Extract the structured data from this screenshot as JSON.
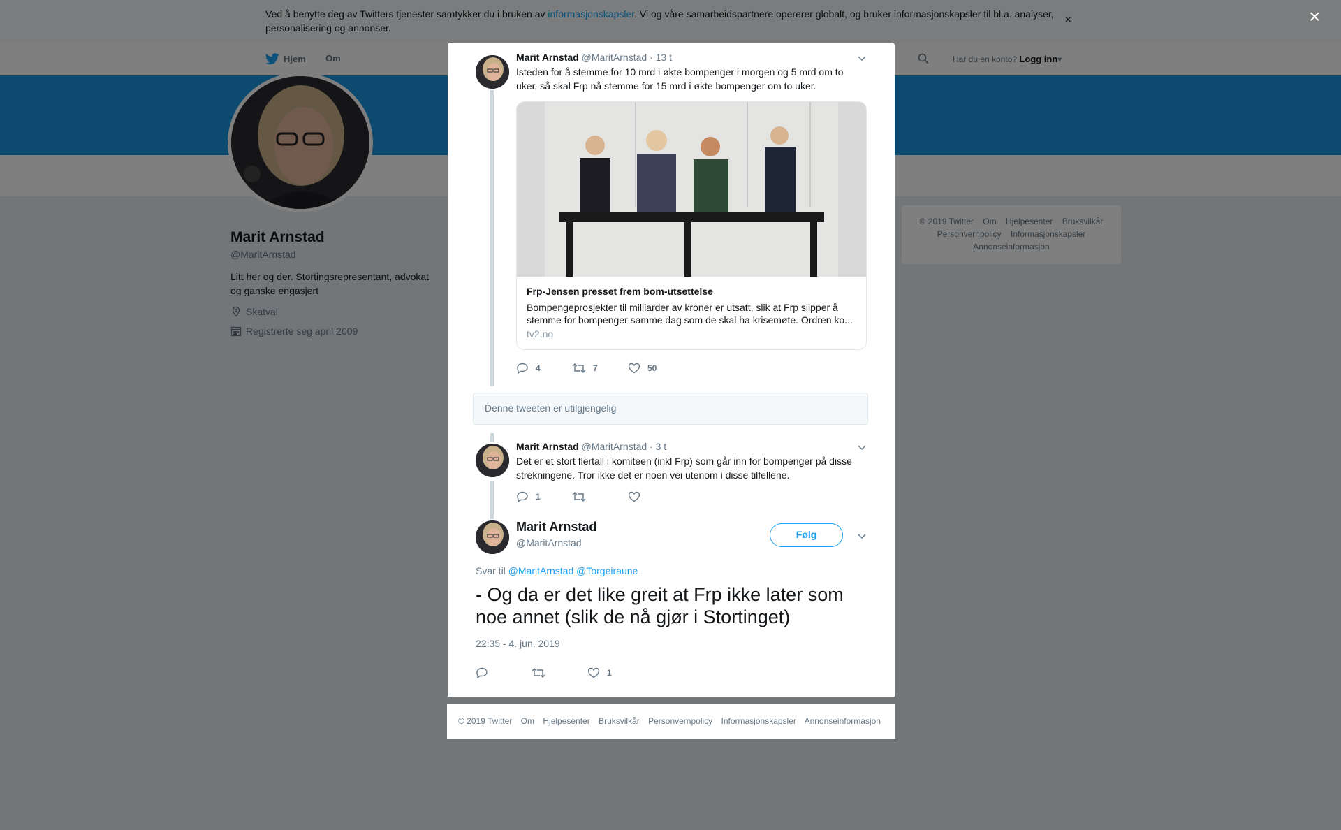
{
  "cookie": {
    "text_before": "Ved å benytte deg av Twitters tjenester samtykker du i bruken av ",
    "link": "informasjonskapsler",
    "text_after": ". Vi og våre samarbeidspartnere opererer globalt, og bruker informasjonskapsler til bl.a. analyser, personalisering og annonser.",
    "close": "×"
  },
  "nav": {
    "home": "Hjem",
    "about": "Om",
    "account_prompt": "Har du en konto?",
    "login": "Logg inn"
  },
  "profile": {
    "name": "Marit Arnstad",
    "handle": "@MaritArnstad",
    "bio": "Litt her og der. Stortingsrepresentant, advokat og ganske engasjert",
    "location": "Skatval",
    "joined": "Registrerte seg april 2009"
  },
  "side_footer": {
    "copyright": "© 2019 Twitter",
    "links": [
      "Om",
      "Hjelpesenter",
      "Bruksvilkår",
      "Personvernpolicy",
      "Informasjonskapsler",
      "Annonseinformasjon"
    ]
  },
  "modal": {
    "close": "×",
    "tweet1": {
      "name": "Marit Arnstad",
      "handle": "@MaritArnstad",
      "time": "· 13 t",
      "text": "Isteden for å stemme for 10 mrd i økte bompenger i morgen og 5 mrd om to uker, så skal Frp nå stemme for 15 mrd i økte bompenger om to uker.",
      "card": {
        "title": "Frp-Jensen presset frem bom-utsettelse",
        "description": "Bompengeprosjekter til milliarder av kroner er utsatt, slik at Frp slipper å stemme for bompenger samme dag som de skal ha krisemøte. Ordren ko...",
        "domain": "tv2.no"
      },
      "replies": "4",
      "retweets": "7",
      "likes": "50"
    },
    "unavailable": "Denne tweeten er utilgjengelig",
    "tweet2": {
      "name": "Marit Arnstad",
      "handle": "@MaritArnstad",
      "time": "· 3 t",
      "text": "Det er et stort flertall i komiteen (inkl Frp) som går inn for bompenger på disse strekningene. Tror ikke det er noen vei utenom i disse tilfellene.",
      "replies": "1"
    },
    "main": {
      "name": "Marit Arnstad",
      "handle": "@MaritArnstad",
      "follow": "Følg",
      "reply_prefix": "Svar til",
      "reply_mentions": "@MaritArnstad @Torgeiraune",
      "text": "- Og da er det like greit at Frp ikke later som noe annet (slik de nå gjør i Stortinget)",
      "timestamp": "22:35 - 4. jun. 2019",
      "likes": "1"
    }
  },
  "modal_footer": {
    "copyright": "© 2019 Twitter",
    "links": [
      "Om",
      "Hjelpesenter",
      "Bruksvilkår",
      "Personvernpolicy",
      "Informasjonskapsler",
      "Annonseinformasjon"
    ]
  },
  "colors": {
    "accent": "#1da1f2",
    "banner": "#1b95e0",
    "muted": "#657786"
  }
}
